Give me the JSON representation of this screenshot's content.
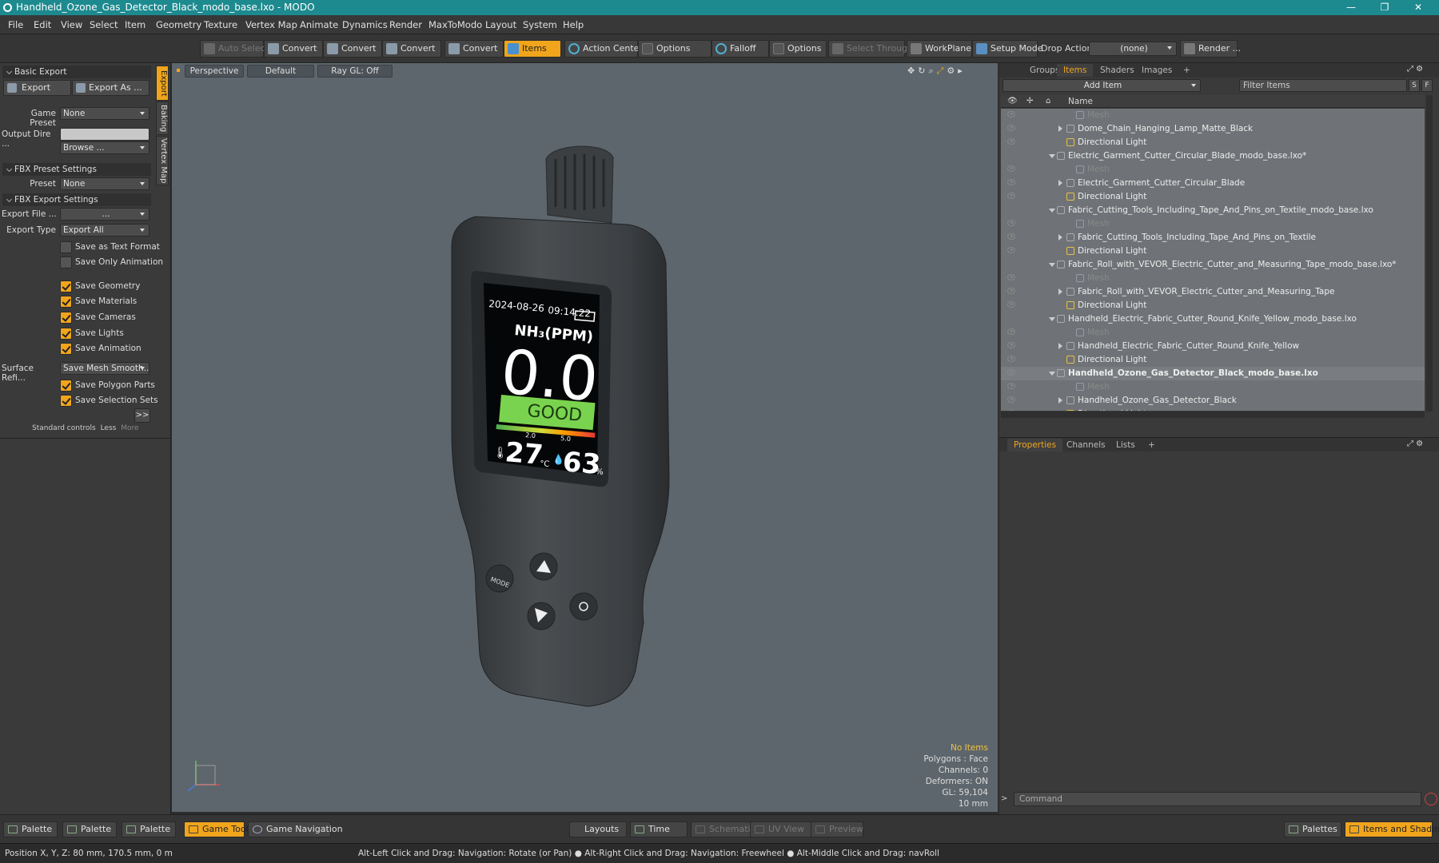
{
  "window": {
    "title": "Handheld_Ozone_Gas_Detector_Black_modo_base.lxo - MODO"
  },
  "menu": [
    "File",
    "Edit",
    "View",
    "Select",
    "Item",
    "Geometry",
    "Texture",
    "Vertex Map",
    "Animate",
    "Dynamics",
    "Render",
    "MaxToModo",
    "Layout",
    "System",
    "Help"
  ],
  "toolbar": {
    "auto_select": "Auto Select",
    "convert": "Convert",
    "items": "Items",
    "action_center": "Action Center",
    "options": "Options",
    "falloff": "Falloff",
    "select_through": "Select Through",
    "workplane": "WorkPlane",
    "setup_mode": "Setup Mode",
    "drop_action_label": "Drop Action",
    "drop_action_value": "(none)",
    "render": "Render ..."
  },
  "left": {
    "basic_export": "Basic Export",
    "export": "Export",
    "export_as": "Export As ...",
    "game_preset_label": "Game Preset",
    "game_preset_value": "None",
    "output_dir_label": "Output Dire ...",
    "browse": "Browse ...",
    "fbx_preset_settings": "FBX Preset Settings",
    "preset_label": "Preset",
    "preset_value": "None",
    "fbx_export_settings": "FBX Export Settings",
    "export_file_label": "Export File ...",
    "export_file_value": "...",
    "export_type_label": "Export Type",
    "export_type_value": "Export All",
    "checks": [
      {
        "label": "Save as Text Format",
        "on": false
      },
      {
        "label": "Save Only Animation",
        "on": false
      },
      {
        "label": "Save Geometry",
        "on": true
      },
      {
        "label": "Save Materials",
        "on": true
      },
      {
        "label": "Save Cameras",
        "on": true
      },
      {
        "label": "Save Lights",
        "on": true
      },
      {
        "label": "Save Animation",
        "on": true
      }
    ],
    "surface_label": "Surface Refi...",
    "surface_value": "Save Mesh Smooth...",
    "checks2": [
      {
        "label": "Save Polygon Parts",
        "on": true
      },
      {
        "label": "Save Selection Sets",
        "on": true
      }
    ],
    "more_btn": ">>",
    "standard_controls": "Standard controls",
    "less": "Less",
    "more": "More",
    "vtabs": [
      "Export",
      "Baking",
      "Vertex Map"
    ]
  },
  "viewport": {
    "perspective": "Perspective",
    "default": "Default",
    "raygl": "Ray GL: Off",
    "info": [
      "No Items",
      "Polygons : Face",
      "Channels: 0",
      "Deformers: ON",
      "GL: 59,104",
      "10 mm"
    ],
    "device": {
      "date": "2024-08-26",
      "time": "09:14:22",
      "gas": "NH₃(PPM)",
      "reading": "0.0",
      "status": "GOOD",
      "scale_a": "2.0",
      "scale_b": "5.0",
      "temp": "27",
      "temp_unit": "°C",
      "humidity": "63",
      "hum_unit": "%",
      "mode_btn": "MODE"
    }
  },
  "items_panel": {
    "tabs": [
      "Groups",
      "Items",
      "Shaders",
      "Images"
    ],
    "add_item": "Add Item",
    "filter": "Filter Items",
    "s": "S",
    "f": "F",
    "name_col": "Name",
    "rows": [
      {
        "indent": 3,
        "type": "mesh",
        "text": "Mesh",
        "eye": true
      },
      {
        "indent": 2,
        "type": "loc",
        "text": "Dome_Chain_Hanging_Lamp_Matte_Black",
        "arrow": "r",
        "eye": true
      },
      {
        "indent": 2,
        "type": "light",
        "text": "Directional Light",
        "eye": true
      },
      {
        "indent": 1,
        "type": "scene",
        "text": "Electric_Garment_Cutter_Circular_Blade_modo_base.lxo*",
        "arrow": "d",
        "eye": false
      },
      {
        "indent": 3,
        "type": "mesh",
        "text": "Mesh",
        "eye": true
      },
      {
        "indent": 2,
        "type": "loc",
        "text": "Electric_Garment_Cutter_Circular_Blade",
        "arrow": "r",
        "eye": true
      },
      {
        "indent": 2,
        "type": "light",
        "text": "Directional Light",
        "eye": true
      },
      {
        "indent": 1,
        "type": "scene",
        "text": "Fabric_Cutting_Tools_Including_Tape_And_Pins_on_Textile_modo_base.lxo",
        "arrow": "d",
        "eye": false
      },
      {
        "indent": 3,
        "type": "mesh",
        "text": "Mesh",
        "eye": true
      },
      {
        "indent": 2,
        "type": "loc",
        "text": "Fabric_Cutting_Tools_Including_Tape_And_Pins_on_Textile",
        "arrow": "r",
        "eye": true
      },
      {
        "indent": 2,
        "type": "light",
        "text": "Directional Light",
        "eye": true
      },
      {
        "indent": 1,
        "type": "scene",
        "text": "Fabric_Roll_with_VEVOR_Electric_Cutter_and_Measuring_Tape_modo_base.lxo*",
        "arrow": "d",
        "eye": false
      },
      {
        "indent": 3,
        "type": "mesh",
        "text": "Mesh",
        "eye": true
      },
      {
        "indent": 2,
        "type": "loc",
        "text": "Fabric_Roll_with_VEVOR_Electric_Cutter_and_Measuring_Tape",
        "arrow": "r",
        "eye": true
      },
      {
        "indent": 2,
        "type": "light",
        "text": "Directional Light",
        "eye": true
      },
      {
        "indent": 1,
        "type": "scene",
        "text": "Handheld_Electric_Fabric_Cutter_Round_Knife_Yellow_modo_base.lxo",
        "arrow": "d",
        "eye": false
      },
      {
        "indent": 3,
        "type": "mesh",
        "text": "Mesh",
        "eye": true
      },
      {
        "indent": 2,
        "type": "loc",
        "text": "Handheld_Electric_Fabric_Cutter_Round_Knife_Yellow",
        "arrow": "r",
        "eye": true
      },
      {
        "indent": 2,
        "type": "light",
        "text": "Directional Light",
        "eye": true
      },
      {
        "indent": 1,
        "type": "scene",
        "text": "Handheld_Ozone_Gas_Detector_Black_modo_base.lxo",
        "arrow": "d",
        "eye": true,
        "bold": true
      },
      {
        "indent": 3,
        "type": "mesh",
        "text": "Mesh",
        "eye": true
      },
      {
        "indent": 2,
        "type": "loc",
        "text": "Handheld_Ozone_Gas_Detector_Black",
        "arrow": "r",
        "eye": true
      },
      {
        "indent": 2,
        "type": "light",
        "text": "Directional Light",
        "eye": true
      }
    ]
  },
  "props_panel": {
    "tabs": [
      "Properties",
      "Channels",
      "Lists"
    ],
    "command": "Command"
  },
  "bottom": {
    "palette": "Palette",
    "game_tools": "Game Tools",
    "game_navigation": "Game Navigation",
    "layouts": "Layouts",
    "time": "Time",
    "schematic": "Schematic",
    "uv_view": "UV View",
    "preview": "Preview",
    "palettes": "Palettes",
    "items_shading": "Items and Shading"
  },
  "status": {
    "position": "Position X, Y, Z:  80 mm, 170.5 mm, 0 m",
    "hint": "Alt-Left Click and Drag: Navigation: Rotate (or Pan) ● Alt-Right Click and Drag: Navigation: Freewheel ● Alt-Middle Click and Drag: navRoll"
  },
  "colors": {
    "accent": "#f0a51c",
    "titlebar": "#1d8a8f",
    "viewport": "#5d666c"
  }
}
